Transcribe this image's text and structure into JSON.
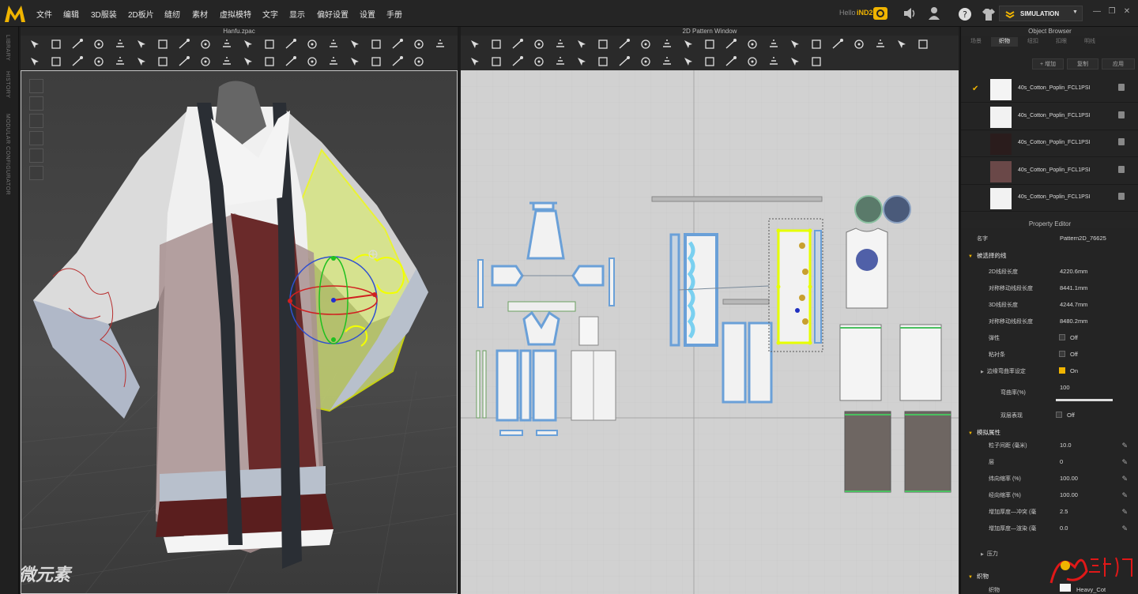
{
  "menubar": {
    "items": [
      "文件",
      "编辑",
      "3D服装",
      "2D板片",
      "缝纫",
      "素材",
      "虚拟模特",
      "文字",
      "显示",
      "偏好设置",
      "设置",
      "手册"
    ],
    "hello": "Hello",
    "user": "iND2018",
    "simulation": "SIMULATION"
  },
  "left_rail": {
    "tabs": [
      "LIBRARY",
      "HISTORY",
      "MODULAR CONFIGURATOR"
    ]
  },
  "view3d": {
    "title": "Hanfu.zpac"
  },
  "view2d": {
    "title": "2D Pattern Window"
  },
  "object_browser": {
    "title": "Object Browser",
    "tabs": [
      "场景",
      "织物",
      "纽扣",
      "扣眼",
      "明线"
    ],
    "active_tab": 1,
    "add_label": "+ 增加",
    "copy_label": "复制",
    "apply_label": "应用",
    "fabrics": [
      {
        "name": "40s_Cotton_Poplin_FCL1PSI",
        "color": "#f4f4f4",
        "checked": true
      },
      {
        "name": "40s_Cotton_Poplin_FCL1PSI",
        "color": "#f2f2f2",
        "checked": false
      },
      {
        "name": "40s_Cotton_Poplin_FCL1PSI",
        "color": "#2a1c1c",
        "checked": false
      },
      {
        "name": "40s_Cotton_Poplin_FCL1PSI",
        "color": "#6a4848",
        "checked": false
      },
      {
        "name": "40s_Cotton_Poplin_FCL1PSI",
        "color": "#f2f2f2",
        "checked": false
      }
    ]
  },
  "property_editor": {
    "title": "Property Editor",
    "name_label": "名字",
    "name_value": "Pattern2D_76625",
    "selected_lines": "被选择的线",
    "rows": [
      {
        "label": "2D线段长度",
        "value": "4220.6mm"
      },
      {
        "label": "对称移动线段长度",
        "value": "8441.1mm"
      },
      {
        "label": "3D线段长度",
        "value": "4244.7mm"
      },
      {
        "label": "对称移动线段长度",
        "value": "8480.2mm"
      }
    ],
    "elastic_label": "弹性",
    "elastic_value": "Off",
    "tape_label": "粘衬条",
    "tape_value": "Off",
    "curvature_label": "边缘弯曲率设定",
    "curvature_value": "On",
    "bend_label": "弯曲率(%)",
    "bend_value": "100",
    "bend_fill": 1.0,
    "double_label": "双层表现",
    "double_value": "Off",
    "sim_section": "模拟属性",
    "sim_rows": [
      {
        "label": "粒子间距 (毫米)",
        "value": "10.0"
      },
      {
        "label": "层",
        "value": "0"
      },
      {
        "label": "纬向缩率 (%)",
        "value": "100.00"
      },
      {
        "label": "经向缩率 (%)",
        "value": "100.00"
      },
      {
        "label": "增加厚度—冲突 (毫",
        "value": "2.5"
      },
      {
        "label": "增加厚度—渲染 (毫",
        "value": "0.0"
      }
    ],
    "pressure_label": "压力",
    "fabric_section": "织物",
    "fabric_label": "织物",
    "fabric_value": "Heavy_Cot"
  },
  "colors": {
    "accent": "#f0b400",
    "selection": "#e6ff00",
    "piece_outline": "#6aa0d8"
  },
  "watermark": "微元素"
}
